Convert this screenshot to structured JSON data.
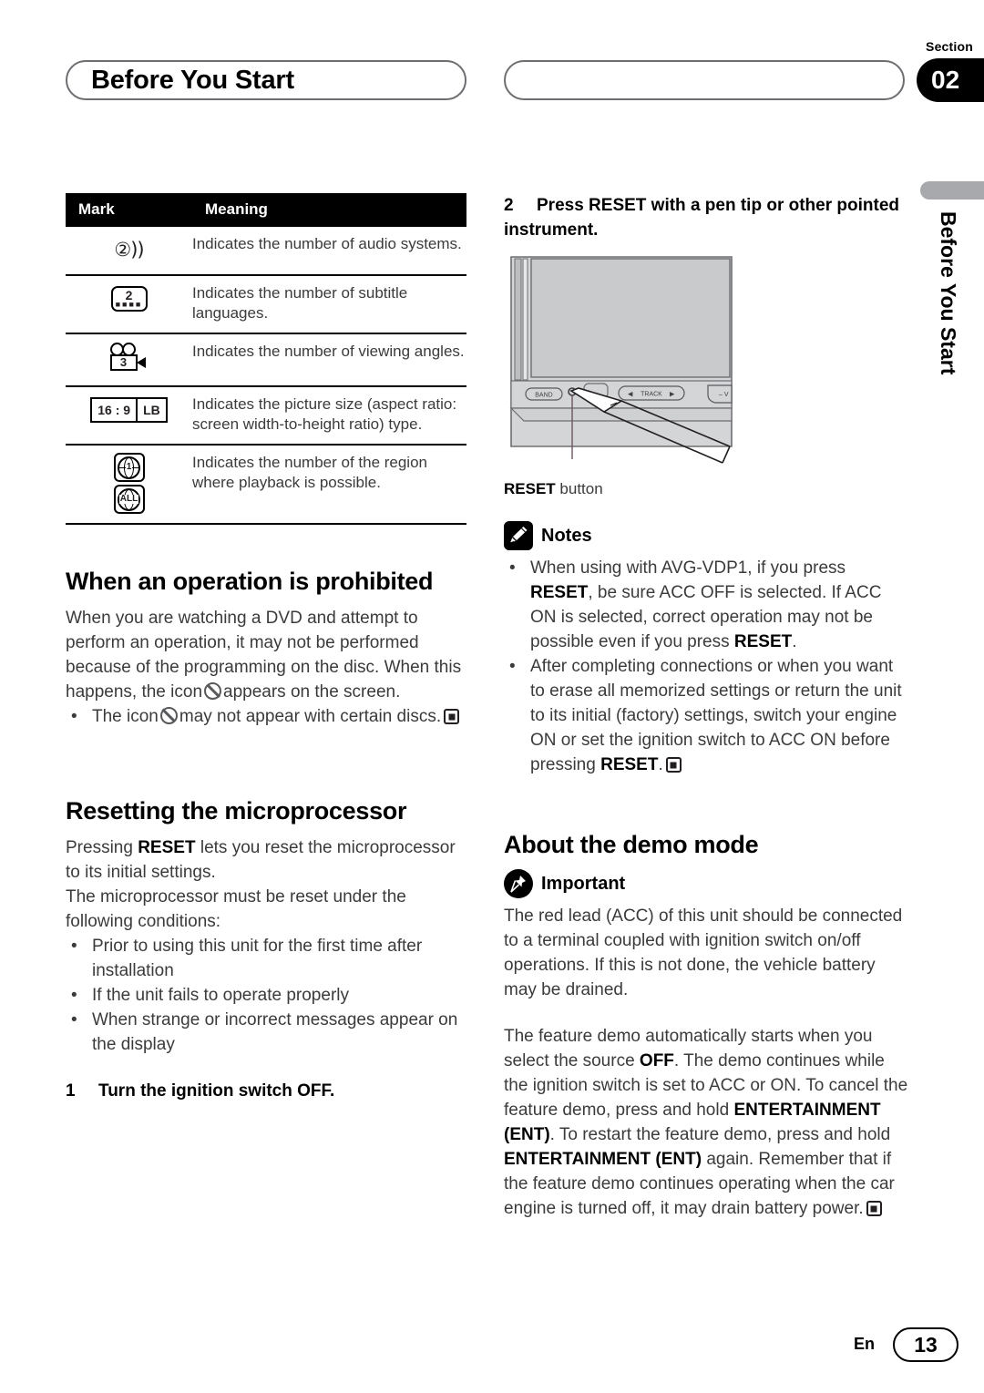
{
  "header": {
    "running_head": "Before You Start",
    "section_label": "Section",
    "section_number": "02"
  },
  "side_tab": {
    "text": "Before You Start"
  },
  "mark_table": {
    "columns": [
      "Mark",
      "Meaning"
    ],
    "rows": [
      {
        "mark_icon": "audio-systems-icon",
        "mark_value": "2",
        "meaning": "Indicates the number of audio systems."
      },
      {
        "mark_icon": "subtitle-languages-icon",
        "mark_value": "2",
        "meaning": "Indicates the number of subtitle languages."
      },
      {
        "mark_icon": "viewing-angles-icon",
        "mark_value": "3",
        "meaning": "Indicates the number of viewing angles."
      },
      {
        "mark_icon": "aspect-ratio-icon",
        "mark_ratio": "16 : 9",
        "mark_mode": "LB",
        "meaning": "Indicates the picture size (aspect ratio: screen width-to-height ratio) type."
      },
      {
        "mark_icon": "region-number-icon",
        "mark_region_1": "1",
        "mark_region_all": "ALL",
        "meaning": "Indicates the number of the region where playback is possible."
      }
    ]
  },
  "prohibited": {
    "heading": "When an operation is prohibited",
    "paragraph_1": "When you are watching a DVD and attempt to perform an operation, it may not be performed because of the programming on the disc. When this happens, the icon",
    "paragraph_1_cont": "appears on the screen.",
    "bullet_1_pre": "The icon",
    "bullet_1_post": "may not appear with certain discs."
  },
  "resetting": {
    "heading": "Resetting the microprocessor",
    "paragraph_1_pre": "Pressing",
    "paragraph_1_bold": "RESET",
    "paragraph_1_post": "lets you reset the microprocessor to its initial settings.",
    "paragraph_2": "The microprocessor must be reset under the following conditions:",
    "bullets": [
      "Prior to using this unit for the first time after installation",
      "If the unit fails to operate properly",
      "When strange or incorrect messages appear on the display"
    ],
    "step_1_number": "1",
    "step_1_text": "Turn the ignition switch OFF."
  },
  "reset_step_2": {
    "number": "2",
    "text": "Press RESET with a pen tip or other pointed instrument.",
    "figure_caption_bold": "RESET",
    "figure_caption_rest": "button",
    "device_labels": {
      "band": "BAND",
      "track": "TRACK",
      "track_prev": "◀",
      "track_next": "▶",
      "volume": "– V"
    }
  },
  "notes": {
    "label": "Notes",
    "icon": "pencil-icon",
    "items": [
      {
        "segments": [
          {
            "text": "When using with AVG-VDP1, if you press ",
            "bold": false
          },
          {
            "text": "RESET",
            "bold": true
          },
          {
            "text": ", be sure ACC OFF is selected. If ACC ON is selected, correct operation may not be possible even if you press ",
            "bold": false
          },
          {
            "text": "RESET",
            "bold": true
          },
          {
            "text": ".",
            "bold": false
          }
        ]
      },
      {
        "segments": [
          {
            "text": "After completing connections or when you want to erase all memorized settings or return the unit to its initial (factory) settings, switch your engine ON or set the ignition switch to ACC ON before pressing ",
            "bold": false
          },
          {
            "text": "RESET",
            "bold": true
          },
          {
            "text": ".",
            "bold": false
          }
        ],
        "endmark": true
      }
    ]
  },
  "demo_mode": {
    "heading": "About the demo mode",
    "important_label": "Important",
    "important_icon": "pushpin-icon",
    "important_text": "The red lead (ACC) of this unit should be connected to a terminal coupled with ignition switch on/off operations. If this is not done, the vehicle battery may be drained.",
    "paragraph_segments": [
      {
        "text": "The feature demo automatically starts when you select the source ",
        "bold": false
      },
      {
        "text": "OFF",
        "bold": true
      },
      {
        "text": ". The demo continues while the ignition switch is set to ACC or ON. To cancel the feature demo, press and hold ",
        "bold": false
      },
      {
        "text": "ENTERTAINMENT (ENT)",
        "bold": true
      },
      {
        "text": ". To restart the feature demo, press and hold ",
        "bold": false
      },
      {
        "text": "ENTERTAINMENT (ENT)",
        "bold": true
      },
      {
        "text": " again. Remember that if the feature demo continues operating when the car engine is turned off, it may drain battery power.",
        "bold": false
      }
    ]
  },
  "footer": {
    "language": "En",
    "page_number": "13"
  },
  "colors": {
    "black": "#000000",
    "body_text": "#3b3b3b",
    "rule": "#000000",
    "tab_gray": "#a7a9ac",
    "device_gray": "#d4d5d7"
  }
}
